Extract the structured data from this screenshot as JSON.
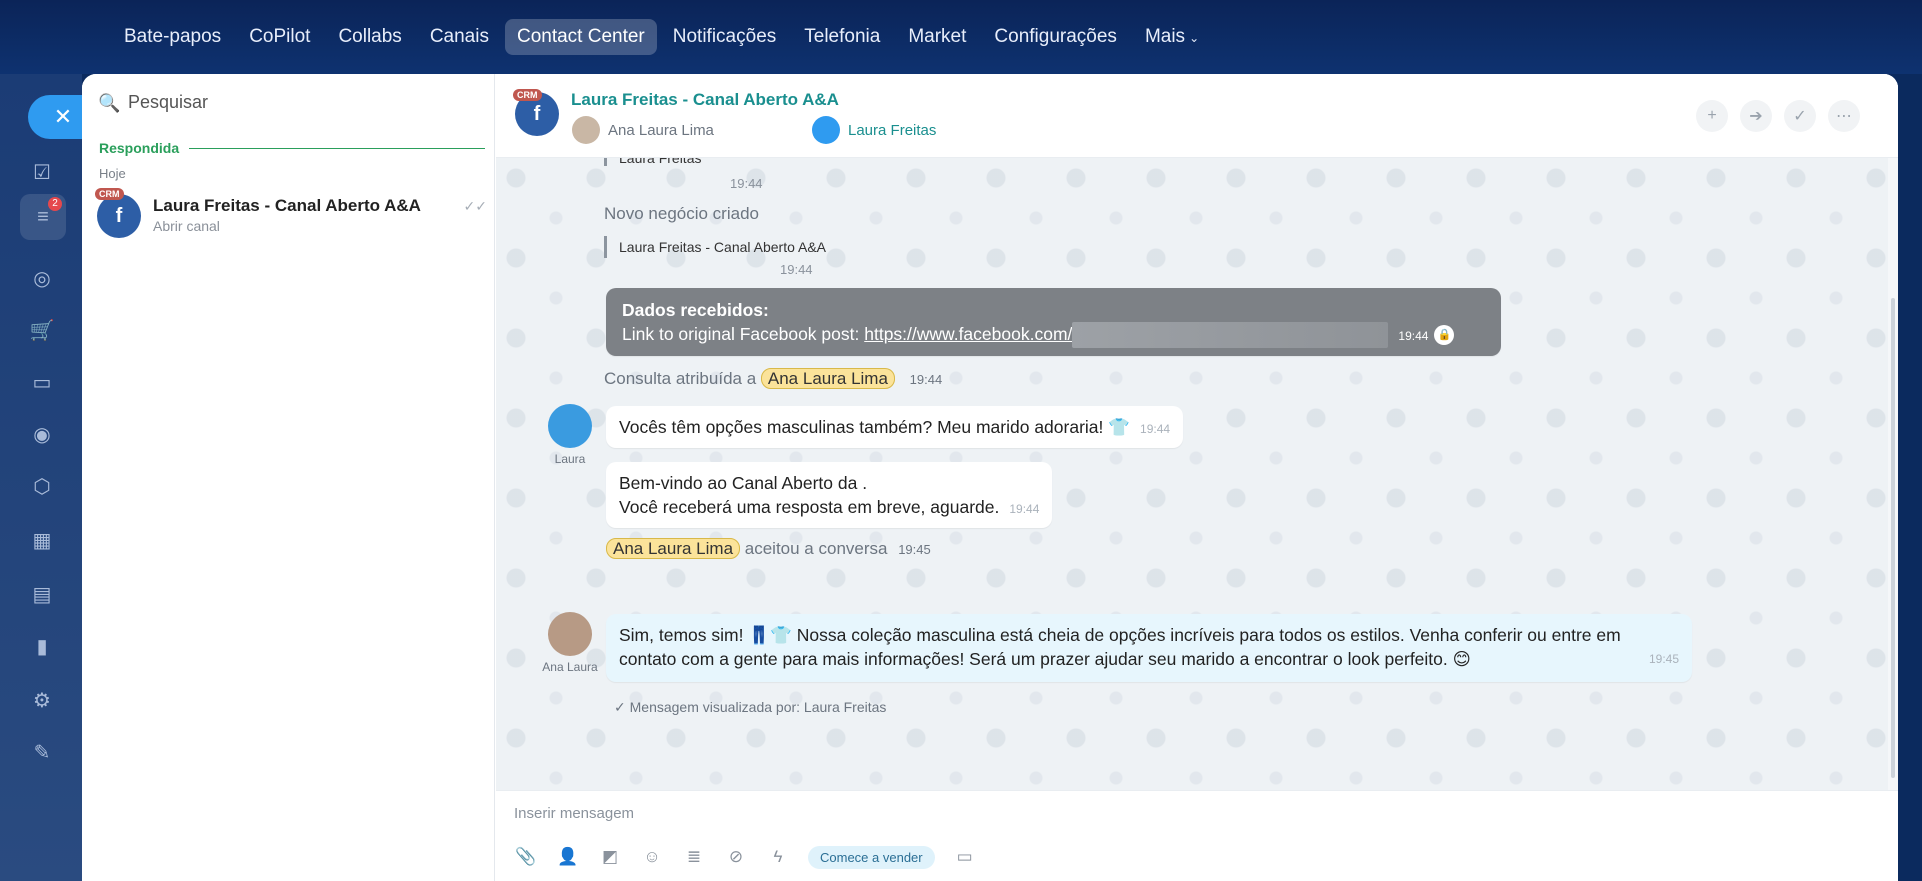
{
  "nav": {
    "items": [
      "Bate-papos",
      "CoPilot",
      "Collabs",
      "Canais",
      "Contact Center",
      "Notificações",
      "Telefonia",
      "Market",
      "Configurações",
      "Mais"
    ],
    "active": "Contact Center"
  },
  "rail": {
    "badge": "2"
  },
  "search": {
    "placeholder": "Pesquisar"
  },
  "list": {
    "section": "Respondida",
    "day": "Hoje",
    "conversation": {
      "crm": "CRM",
      "title": "Laura Freitas - Canal Aberto A&A",
      "subtitle": "Abrir canal"
    }
  },
  "header": {
    "crm": "CRM",
    "title": "Laura Freitas - Canal Aberto A&A",
    "member1": "Ana Laura Lima",
    "member2": "Laura Freitas"
  },
  "messages": {
    "top_quote": "Laura Freitas",
    "top_time": "19:44",
    "new_deal_label": "Novo negócio criado",
    "new_deal_quote": "Laura Freitas - Canal Aberto A&A",
    "new_deal_time": "19:44",
    "data_title": "Dados recebidos:",
    "data_link_prefix": "Link to original Facebook post: ",
    "data_link": "https://www.facebook.com/",
    "data_time": "19:44",
    "assigned_prefix": "Consulta atribuída a",
    "assigned_name": "Ana Laura Lima",
    "assigned_time": "19:44",
    "client_msg": "Vocês têm opções masculinas também? Meu marido adoraria! 👕",
    "client_time": "19:44",
    "client_name": "Laura",
    "welcome_line1": "Bem-vindo ao Canal Aberto da .",
    "welcome_line2": "Você receberá uma resposta em breve, aguarde.",
    "welcome_time": "19:44",
    "accepted_name": "Ana Laura Lima",
    "accepted_text": "aceitou a conversa",
    "accepted_time": "19:45",
    "agent_line1": "Sim, temos sim! 👖👕 Nossa coleção masculina está cheia de opções incríveis para todos os estilos. Venha conferir ou entre em",
    "agent_line2": "contato com a gente para mais informações! Será um prazer ajudar seu marido a encontrar o look perfeito. 😊",
    "agent_time": "19:45",
    "agent_name": "Ana Laura",
    "seen": "Mensagem visualizada por: Laura Freitas"
  },
  "composer": {
    "placeholder": "Inserir mensagem",
    "sell_label": "Comece a vender"
  },
  "colors": {
    "nav_bg": "#0b2458",
    "accent_green": "#2a9f5b",
    "title_teal": "#1a8f8f",
    "close_blue": "#2f9bf0"
  }
}
